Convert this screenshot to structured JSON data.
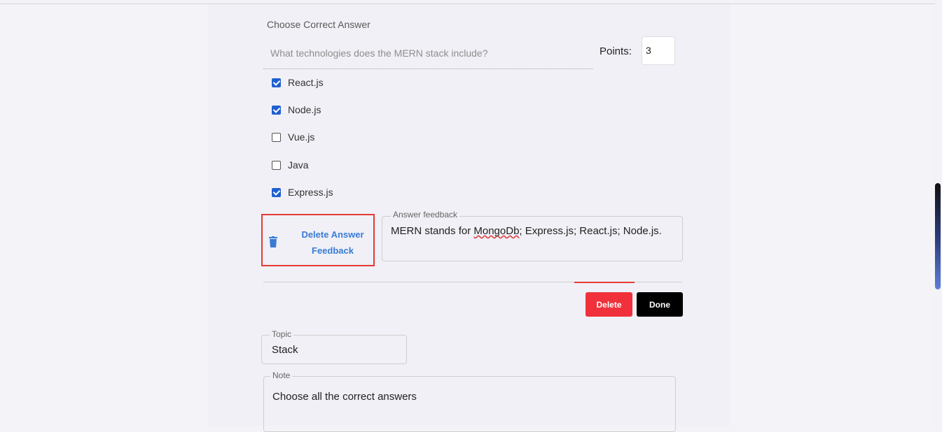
{
  "question": {
    "section_label": "Choose Correct Answer",
    "placeholder": "What technologies does the MERN stack include?",
    "points_label": "Points:",
    "points_value": "3"
  },
  "options": [
    {
      "label": "React.js",
      "checked": true
    },
    {
      "label": "Node.js",
      "checked": true
    },
    {
      "label": "Vue.js",
      "checked": false
    },
    {
      "label": "Java",
      "checked": false
    },
    {
      "label": "Express.js",
      "checked": true
    }
  ],
  "feedback": {
    "delete_label": "Delete Answer Feedback",
    "legend": "Answer feedback",
    "text_before": "MERN stands for ",
    "text_misspelled": "MongoDb",
    "text_after": "; Express.js; React.js; Node.js."
  },
  "actions": {
    "delete_label": "Delete",
    "done_label": "Done"
  },
  "topic": {
    "legend": "Topic",
    "value": "Stack"
  },
  "note": {
    "legend": "Note",
    "value": "Choose all the correct answers"
  },
  "colors": {
    "accent_blue": "#3a7bd5",
    "checkbox_blue": "#1f5fd1",
    "danger_red": "#f0313b",
    "highlight_red": "#e53935"
  }
}
